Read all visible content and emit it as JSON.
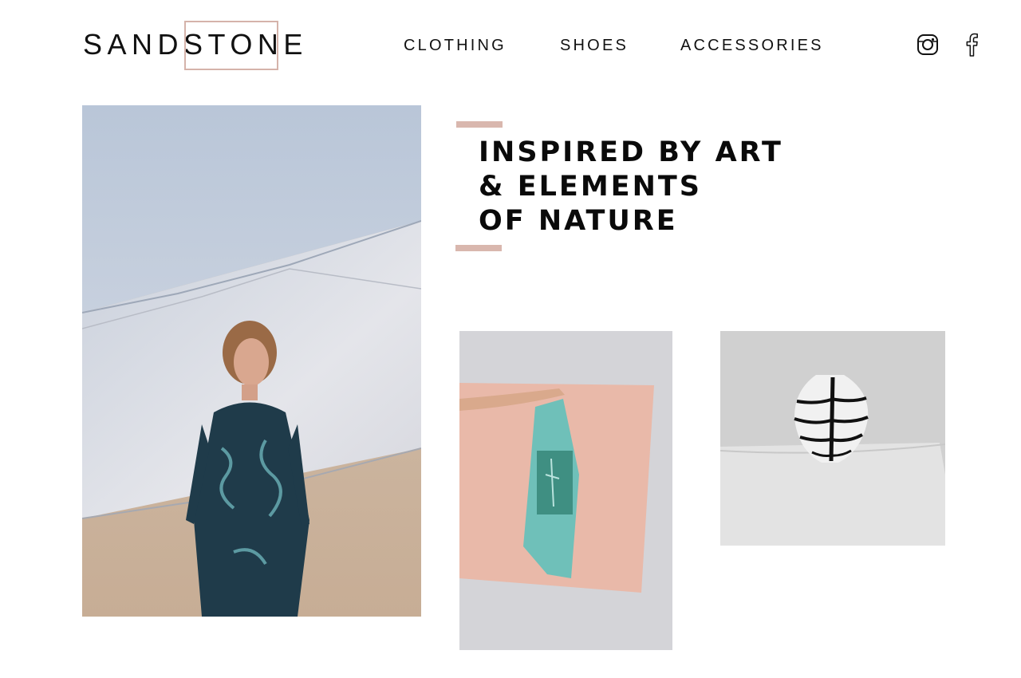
{
  "brand": {
    "name": "SANDSTONE",
    "accent_color": "#d9b7ae"
  },
  "nav": {
    "items": [
      {
        "label": "CLOTHING"
      },
      {
        "label": "SHOES"
      },
      {
        "label": "ACCESSORIES"
      }
    ]
  },
  "social": {
    "instagram_icon": "instagram-icon",
    "facebook_icon": "facebook-icon"
  },
  "hero": {
    "headline_lines": [
      "INSPIRED BY ART",
      "& ELEMENTS",
      "OF NATURE"
    ]
  },
  "gallery": {
    "images": [
      {
        "subject": "model-in-dress-photo"
      },
      {
        "subject": "scarf-photo"
      },
      {
        "subject": "vase-photo"
      }
    ]
  }
}
